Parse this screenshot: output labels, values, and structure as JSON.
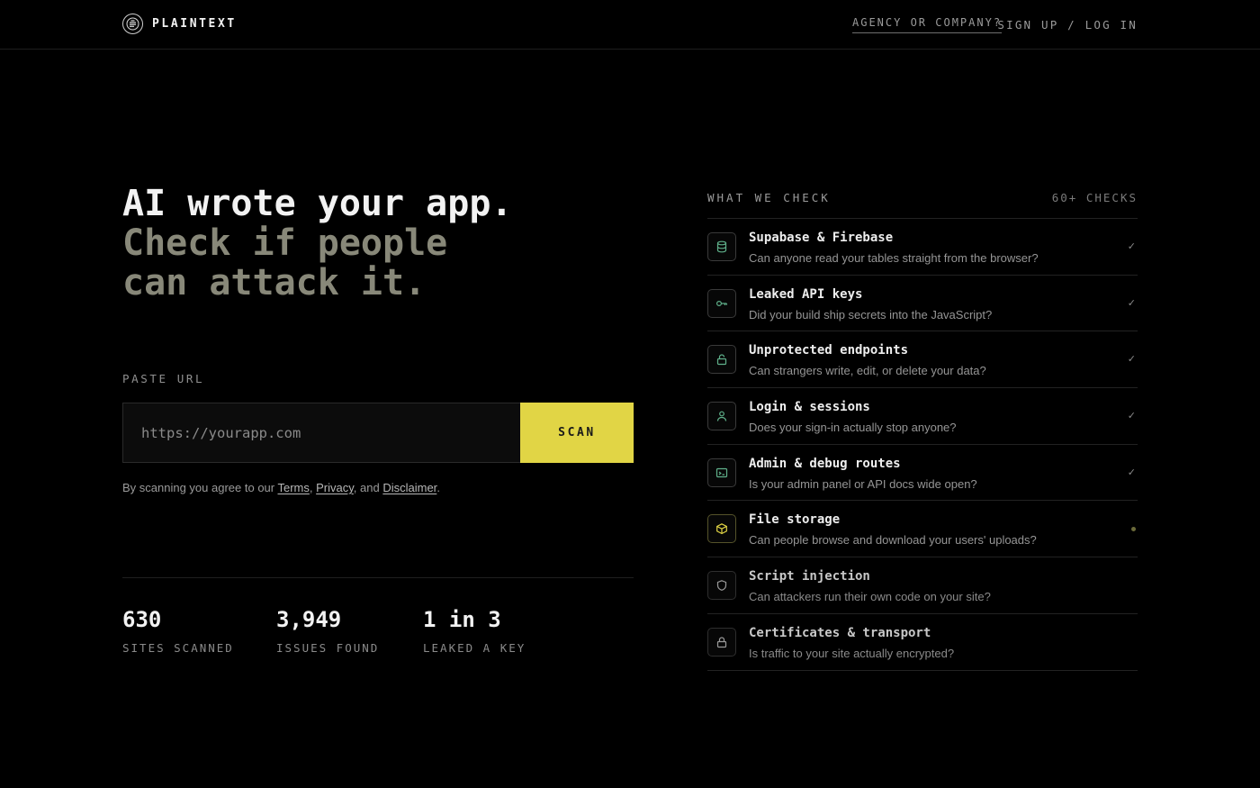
{
  "header": {
    "brand": "PLAINTEXT",
    "agency_link": "AGENCY OR COMPANY?",
    "auth_link": "SIGN UP / LOG IN"
  },
  "hero": {
    "line1": "AI wrote your app.",
    "line2": "Check if people",
    "line3": "can attack it."
  },
  "scan": {
    "label": "PASTE URL",
    "placeholder": "https://yourapp.com",
    "button": "SCAN",
    "agree_prefix": "By scanning you agree to our",
    "terms": "Terms",
    "privacy": "Privacy",
    "and": "and",
    "disclaimer": "Disclaimer"
  },
  "stats": [
    {
      "value": "630",
      "label": "SITES SCANNED"
    },
    {
      "value": "3,949",
      "label": "ISSUES FOUND"
    },
    {
      "value": "1 in 3",
      "label": "LEAKED A KEY"
    }
  ],
  "checks": {
    "title": "WHAT WE CHECK",
    "count": "60+ CHECKS",
    "items": [
      {
        "title": "Supabase & Firebase",
        "desc": "Can anyone read your tables straight from the browser?",
        "icon": "database-icon",
        "status": "done",
        "mark": "✓"
      },
      {
        "title": "Leaked API keys",
        "desc": "Did your build ship secrets into the JavaScript?",
        "icon": "key-icon",
        "status": "done",
        "mark": "✓"
      },
      {
        "title": "Unprotected endpoints",
        "desc": "Can strangers write, edit, or delete your data?",
        "icon": "unlock-icon",
        "status": "done",
        "mark": "✓"
      },
      {
        "title": "Login & sessions",
        "desc": "Does your sign-in actually stop anyone?",
        "icon": "user-icon",
        "status": "done",
        "mark": "✓"
      },
      {
        "title": "Admin & debug routes",
        "desc": "Is your admin panel or API docs wide open?",
        "icon": "terminal-icon",
        "status": "done",
        "mark": "✓"
      },
      {
        "title": "File storage",
        "desc": "Can people browse and download your users' uploads?",
        "icon": "box-icon",
        "status": "in-progress"
      },
      {
        "title": "Script injection",
        "desc": "Can attackers run their own code on your site?",
        "icon": "shield-icon",
        "status": "pending"
      },
      {
        "title": "Certificates & transport",
        "desc": "Is traffic to your site actually encrypted?",
        "icon": "lock-icon",
        "status": "pending"
      }
    ]
  },
  "colors": {
    "accent": "#e1d545",
    "success": "#5fb08a",
    "background": "#000000"
  }
}
